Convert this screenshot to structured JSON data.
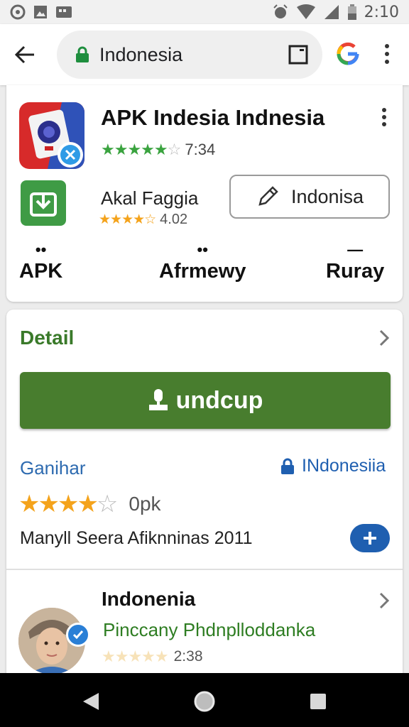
{
  "status_bar": {
    "time": "2:10"
  },
  "browser": {
    "url_text": "Indonesia"
  },
  "app_card": {
    "title": "APK Indesia Indnesia",
    "rating_value": "7:34",
    "subtitle": "Akal Faggia",
    "sub_rating_value": "4.02",
    "outline_button_label": "Indonisa",
    "stats": [
      {
        "mark": "••",
        "label": "APK"
      },
      {
        "mark": "••",
        "label": "Afrmewy"
      },
      {
        "mark": "—",
        "label": "Ruray"
      }
    ]
  },
  "details_card": {
    "section_title": "Detail",
    "primary_button_label": "undcup",
    "genre_link": "Ganihar",
    "lock_link": "INdonesiia",
    "rating_value": "0pk",
    "rating_stars": 4,
    "info_line": "Manyll Seera Afiknninas 2011"
  },
  "developer_card": {
    "name": "Indonenia",
    "subtitle": "Pinccany Phdnplloddanka",
    "rating_value": "2:38"
  },
  "colors": {
    "primary_green": "#487d2e",
    "link_blue": "#2e6bb0",
    "star_orange": "#f4a31c",
    "star_green": "#3aa33f"
  }
}
